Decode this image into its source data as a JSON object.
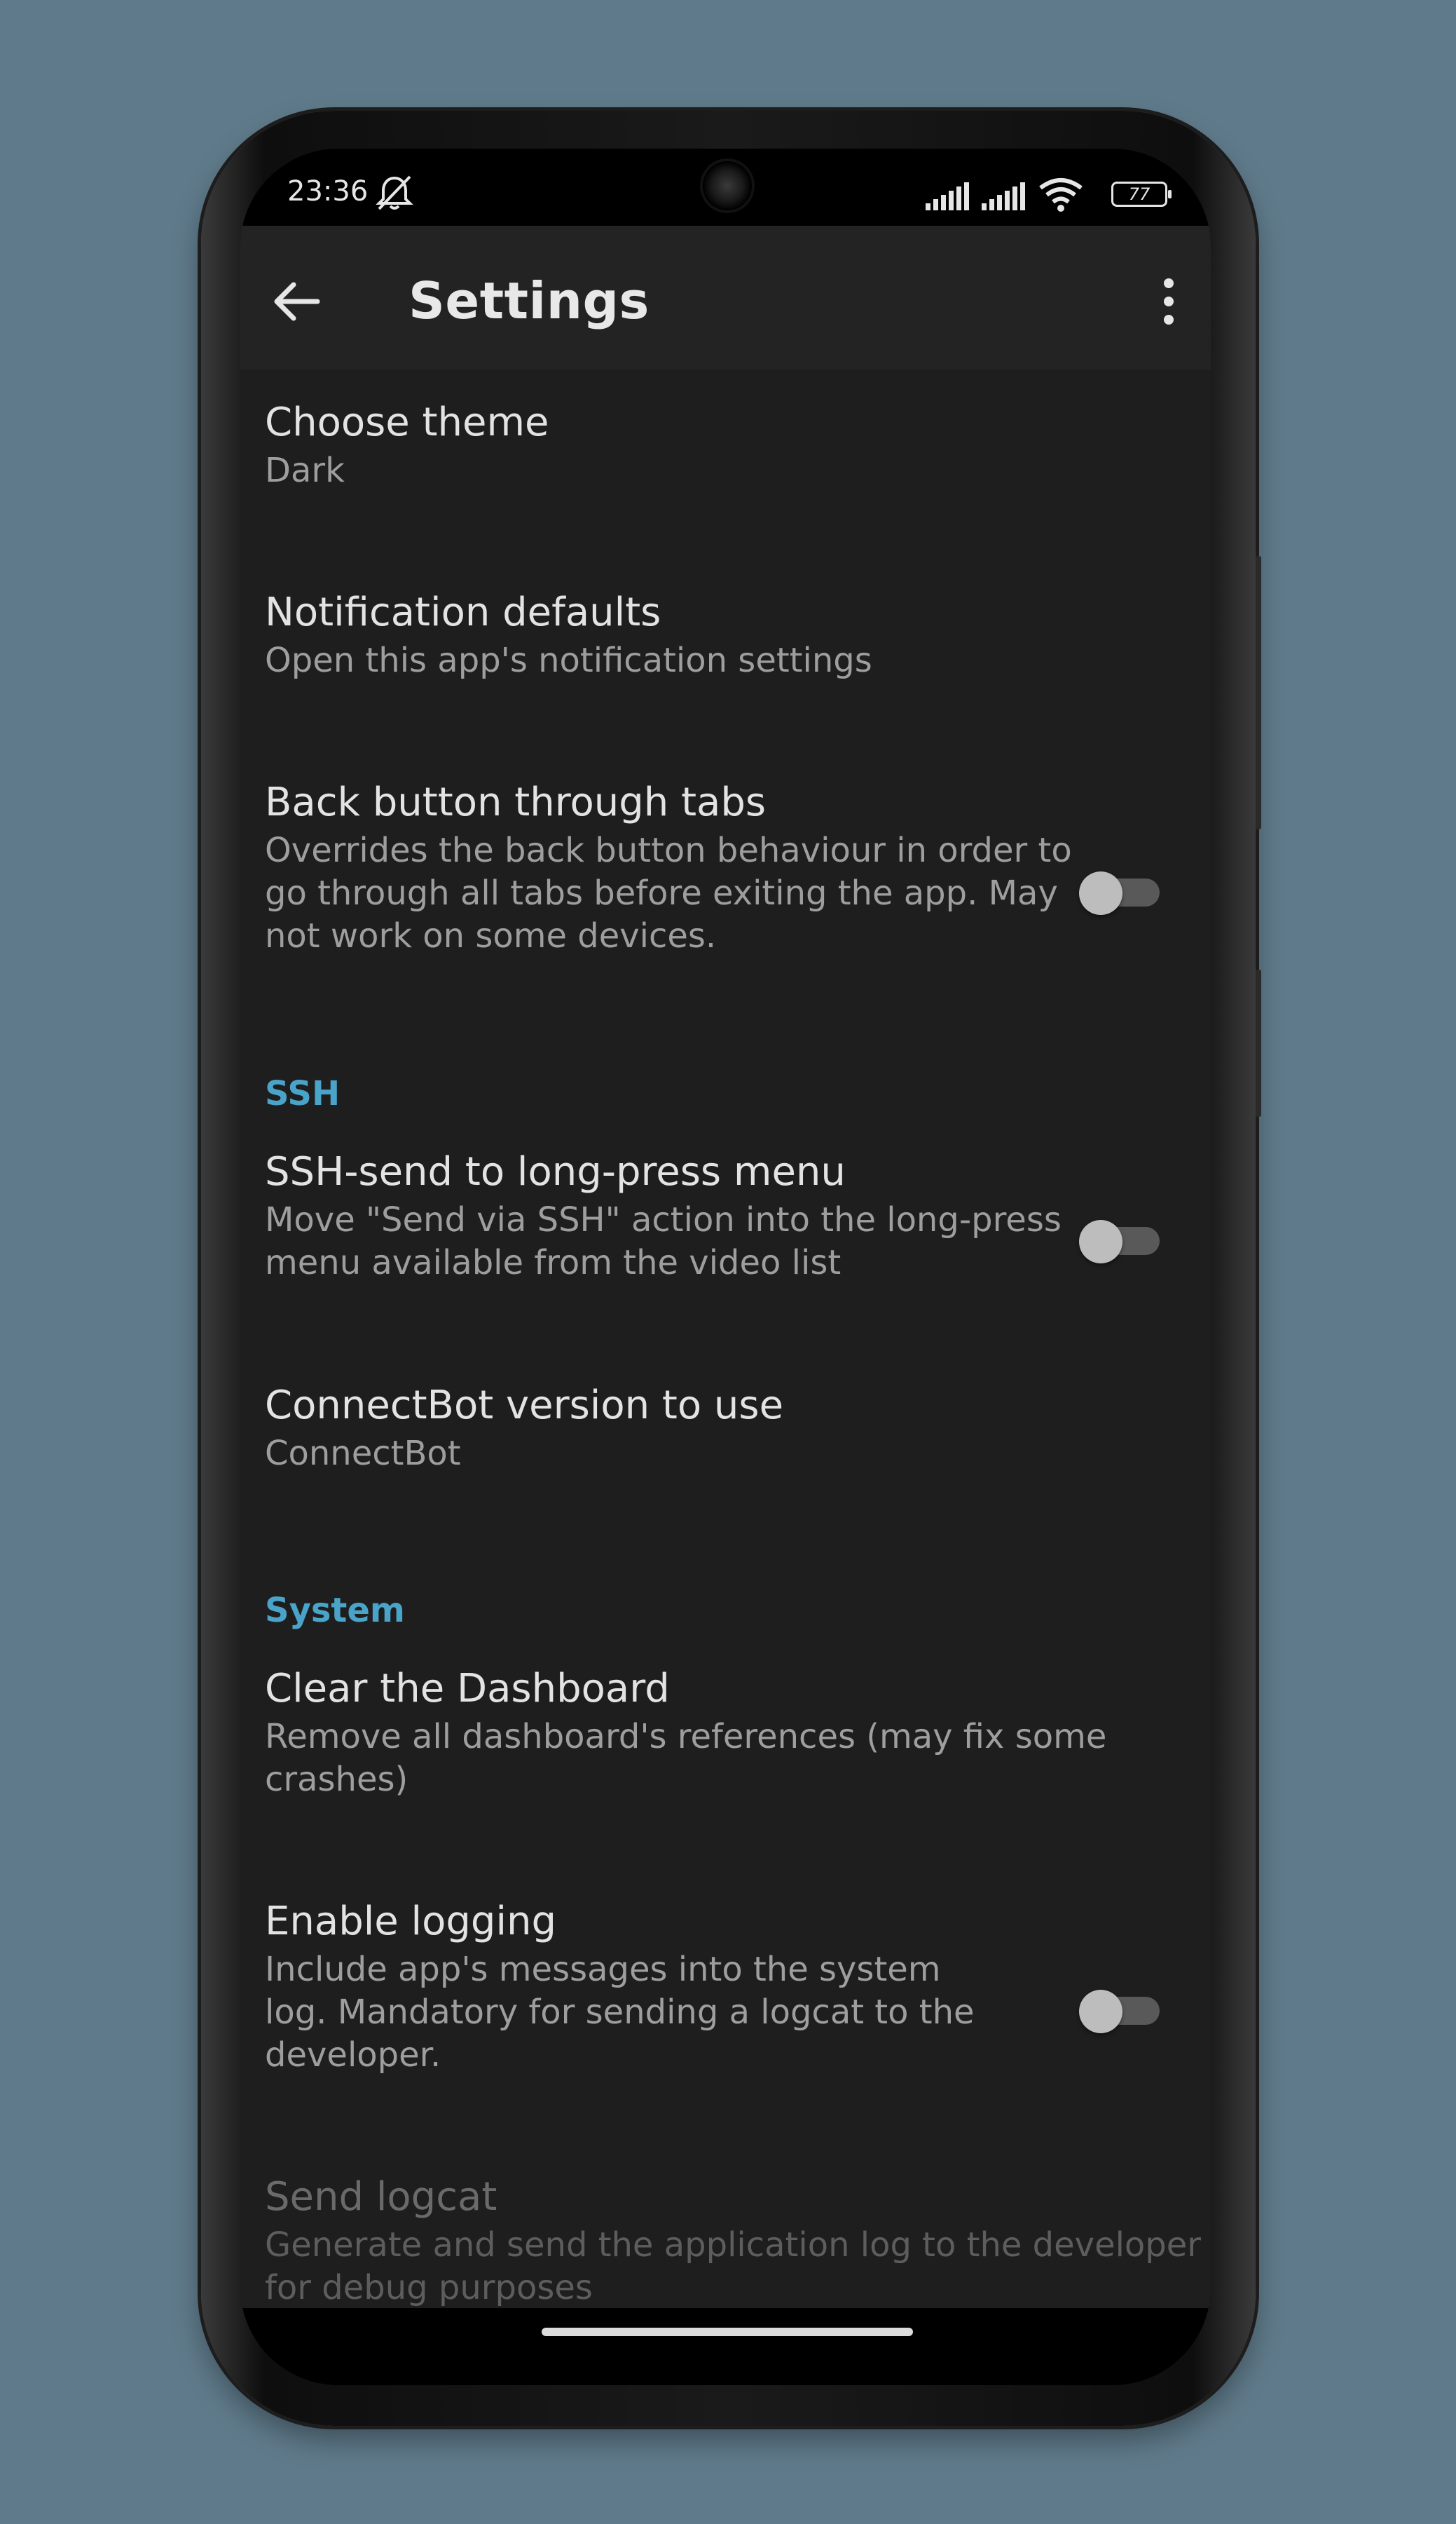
{
  "status_bar": {
    "time": "23:36",
    "battery": "77",
    "icons": [
      "silent-icon",
      "signal-icon",
      "signal-icon",
      "wifi-icon",
      "battery-icon"
    ]
  },
  "toolbar": {
    "back_icon": "arrow-left-icon",
    "title": "Settings",
    "more_icon": "more-vertical-icon"
  },
  "settings": [
    {
      "title": "Choose theme",
      "summary": "Dark"
    },
    {
      "title": "Notification defaults",
      "summary": "Open this app's notification settings"
    },
    {
      "title": "Back button through tabs",
      "summary_lines": [
        "Overrides the back button behaviour in order to",
        "go through all tabs before exiting the app. May",
        "not work on some devices."
      ],
      "switch": false
    },
    {
      "category": "SSH"
    },
    {
      "title": "SSH-send to long-press menu",
      "summary_lines": [
        "Move \"Send via SSH\" action into the long-press",
        "menu available from the video list"
      ],
      "switch": false
    },
    {
      "title": "ConnectBot version to use",
      "summary": "ConnectBot"
    },
    {
      "category": "System"
    },
    {
      "title": "Clear the Dashboard",
      "summary_lines": [
        "Remove all dashboard's references (may fix some",
        "crashes)"
      ]
    },
    {
      "title": "Enable logging",
      "summary_lines": [
        "Include app's messages into the system",
        "log. Mandatory for sending a logcat to the",
        "developer."
      ],
      "switch": false
    },
    {
      "title": "Send logcat",
      "summary_lines": [
        "Generate and send the application log to the developer",
        "for debug purposes"
      ],
      "disabled": true
    }
  ],
  "colors": {
    "background": "#5f7a8a",
    "screen": "#1e1e1e",
    "toolbar": "#232323",
    "accent": "#4aa3c8"
  }
}
